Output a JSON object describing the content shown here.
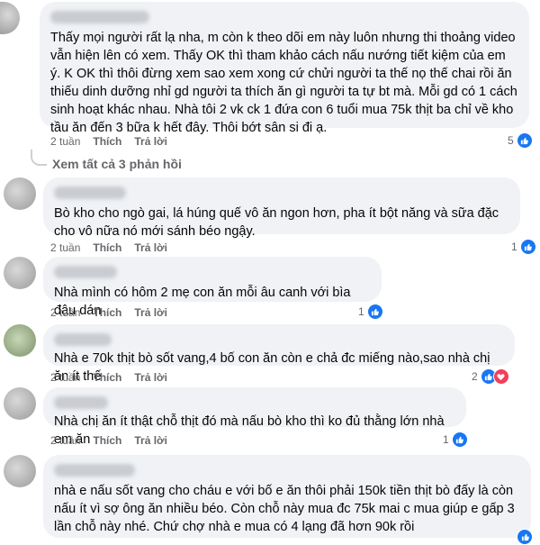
{
  "comments": [
    {
      "text": "Thấy mọi người rất lạ nha, m còn k theo dõi em này luôn nhưng thi thoảng video vẫn hiện lên có xem. Thấy OK thì tham khảo cách nấu nướng tiết kiệm của em ý. K OK thì thôi đừng xem sao xem xong cứ chửi người ta thế nọ thế chai rồi ăn thiếu dinh dưỡng nhỉ gd người ta thích ăn gì người ta tự bt mà. Mỗi gd có 1 cách sinh hoạt khác nhau. Nhà tôi 2 vk ck 1 đứa con 6 tuổi mua 75k thịt ba chỉ về kho tầu ăn đến 3 bữa k hết đây. Thôi bớt sân si đi ạ.",
      "time": "2 tuần",
      "like": "Thích",
      "reply": "Trả lời",
      "reactions": "5"
    },
    {
      "text": "Bò kho cho ngò gai, lá húng quế vô ăn ngon hơn, pha ít bột năng và sữa đặc cho vô nữa nó mới sánh béo ngậy.",
      "time": "2 tuần",
      "like": "Thích",
      "reply": "Trả lời",
      "reactions": "1"
    },
    {
      "text": "Nhà mình có hôm 2 mẹ con ăn mỗi âu canh với bìa đậu dán",
      "time": "2 tuần",
      "like": "Thích",
      "reply": "Trả lời",
      "reactions": "1"
    },
    {
      "text": "Nhà e 70k thịt bò sốt vang,4 bố con ăn còn e chả đc miếng nào,sao nhà chị ăn ít thế",
      "time": "2 tuần",
      "like": "Thích",
      "reply": "Trả lời",
      "reactions": "2"
    },
    {
      "text": "Nhà chị ăn ít thật chỗ thịt đó mà nấu bò kho thì ko đủ thằng lớn nhà em ăn",
      "time": "2 tuần",
      "like": "Thích",
      "reply": "Trả lời",
      "reactions": "1"
    },
    {
      "text": "nhà e nấu sốt vang cho cháu e với bố e ăn thôi phải 150k tiền thịt bò đấy là còn nấu ít vì sợ ông ăn nhiều béo. Còn chỗ này mua đc 75k mai c mua giúp e gấp 3 lần chỗ này nhé. Chứ chợ nhà e mua có 4 lạng đã hơn 90k rồi",
      "time": "",
      "like": "",
      "reply": "",
      "reactions": ""
    }
  ],
  "view_replies": "Xem tất cả 3 phản hồi",
  "colors": {
    "like": "#1877f2",
    "heart": "#f33e58",
    "bubble": "#f0f2f5",
    "meta": "#65676b"
  }
}
